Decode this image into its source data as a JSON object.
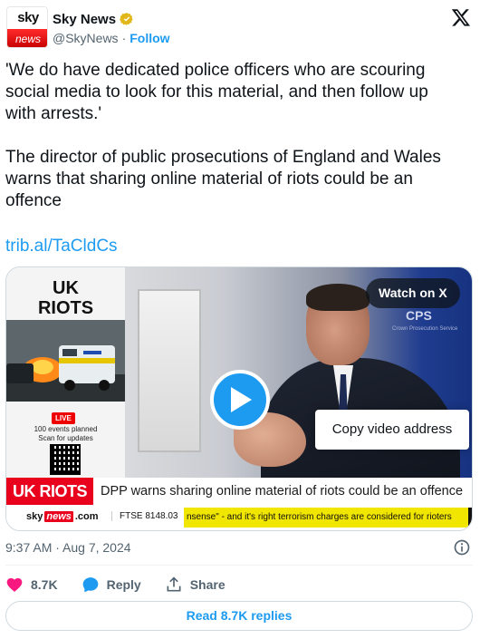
{
  "author": {
    "avatar_top": "sky",
    "avatar_bottom": "news",
    "display_name": "Sky News",
    "handle": "@SkyNews",
    "separator": "·",
    "follow_label": "Follow",
    "verified_color": "#e2b719"
  },
  "tweet": {
    "text": "'We do have dedicated police officers who are scouring social media to look for this material, and then follow up with arrests.'\n\nThe director of public prosecutions of England and Wales warns that sharing online material of riots could be an offence",
    "link": "trib.al/TaCldCs"
  },
  "video": {
    "side_title": "UK\nRIOTS",
    "live_label": "LIVE",
    "events_text": "100 events planned\nScan for updates",
    "cps_text": "CPS",
    "cps_subtext": "Crown Prosecution Service",
    "watch_label": "Watch on X",
    "copy_address_label": "Copy video address",
    "lower_tag": "UK RIOTS",
    "lower_headline": "DPP warns sharing online material of riots could be an offence",
    "ticker_logo_sky": "sky",
    "ticker_logo_news": "news",
    "ticker_logo_domain": ".com",
    "ftse": "FTSE 8148.03",
    "ticker_text": "nsense\" - and it's right terrorism charges are considered for rioters"
  },
  "meta": {
    "timestamp": "9:37 AM · Aug 7, 2024"
  },
  "actions": {
    "likes": "8.7K",
    "reply_label": "Reply",
    "share_label": "Share",
    "like_color": "#f91880",
    "reply_color": "#1d9bf0"
  },
  "replies_button": "Read 8.7K replies"
}
